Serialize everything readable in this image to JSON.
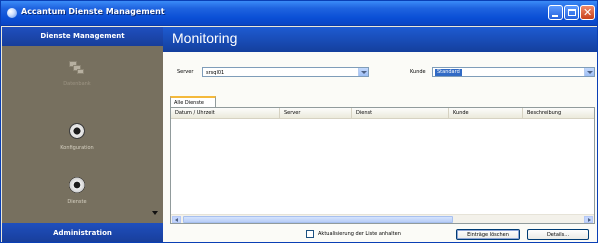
{
  "window": {
    "title": "Accantum Dienste Management"
  },
  "nav": {
    "header": "Dienste Management",
    "items": [
      {
        "label": "Datenbank",
        "icon": "database-icon"
      },
      {
        "label": "Konfiguration",
        "icon": "gear-icon"
      },
      {
        "label": "Dienste",
        "icon": "cog-icon"
      }
    ],
    "footer": "Administration"
  },
  "main": {
    "title": "Monitoring",
    "server_label": "Server",
    "server_value": "srsql01",
    "kunde_label": "Kunde",
    "kunde_value": "Standard",
    "tab": "Alle Dienste",
    "columns": [
      "Datum / Uhrzeit",
      "Server",
      "Dienst",
      "Kunde",
      "Beschreibung"
    ],
    "checkbox_label": "Aktualisierung der Liste anhalten",
    "buttons": {
      "cancel": "Einträge löschen",
      "details": "Details..."
    }
  },
  "colors": {
    "accent": "#1e5bd2",
    "nav_bg": "#77705f",
    "selection": "#316ac5"
  }
}
